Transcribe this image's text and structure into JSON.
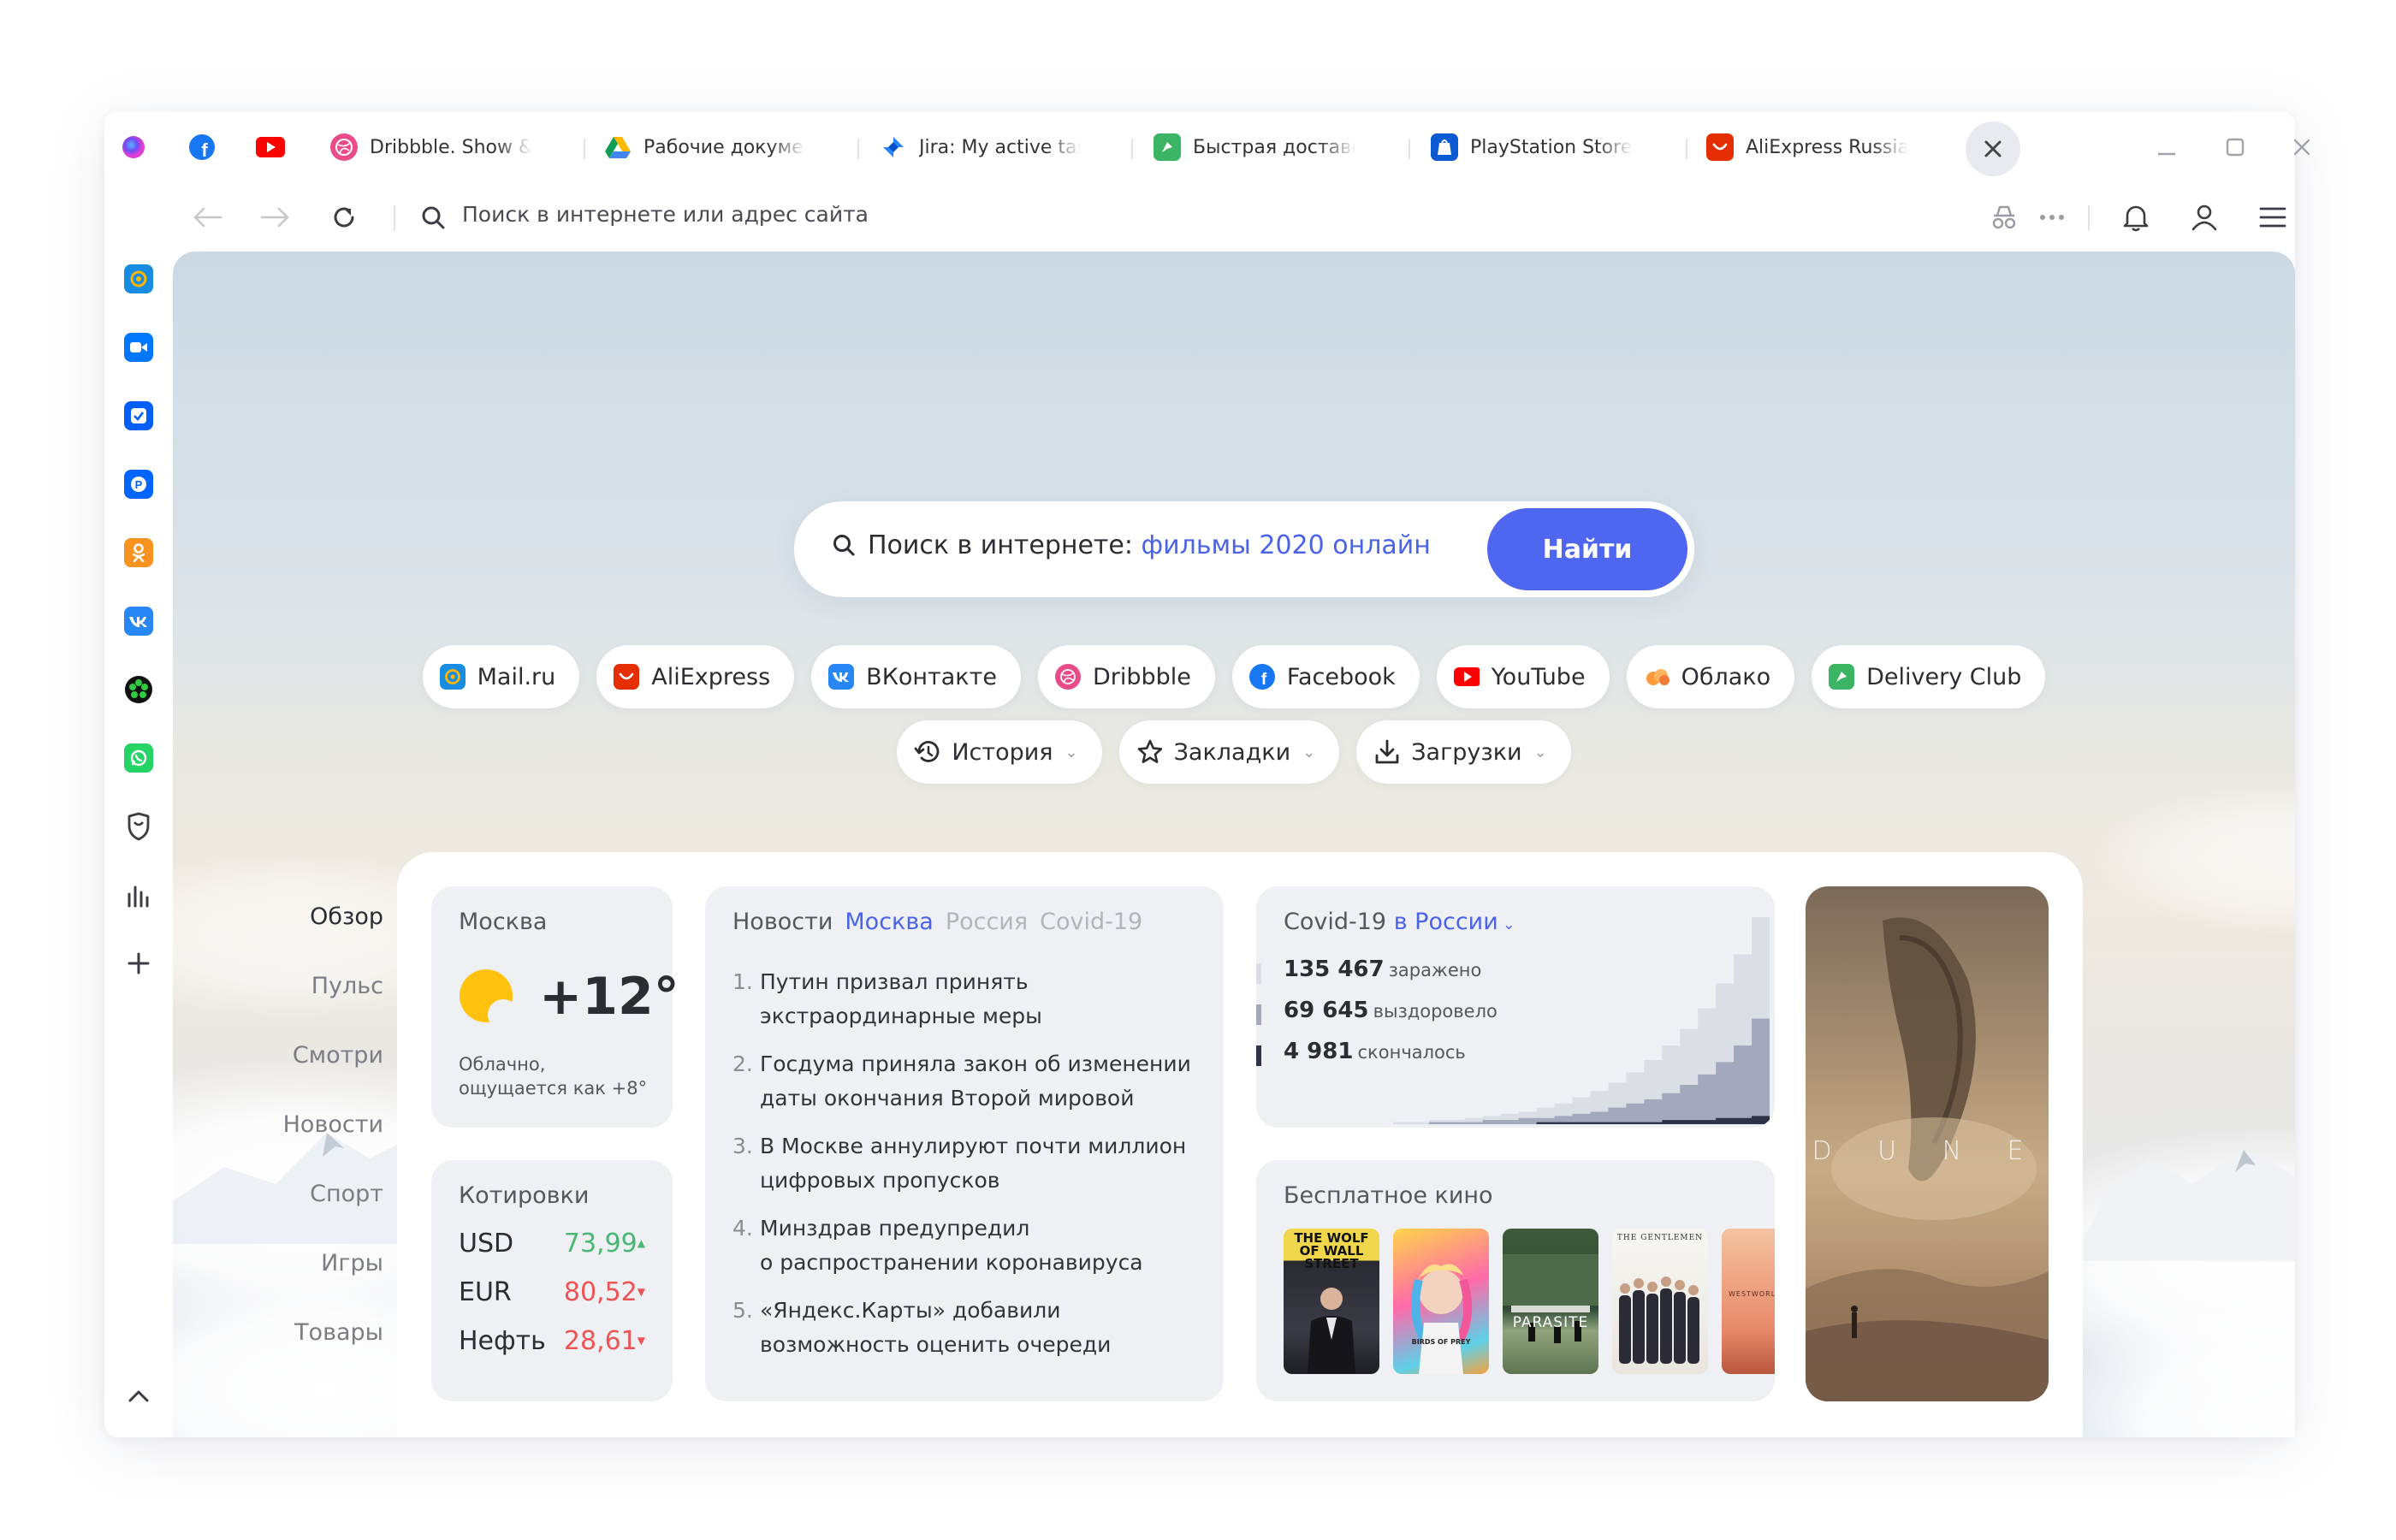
{
  "tabs": [
    {
      "title": "Dribbble. Show & tell for designers"
    },
    {
      "title": "Рабочие документы"
    },
    {
      "title": "Jira: My active tasks"
    },
    {
      "title": "Быстрая доставка"
    },
    {
      "title": "PlayStation Store"
    },
    {
      "title": "AliExpress Russia"
    }
  ],
  "toolbar": {
    "address_placeholder": "Поиск в интернете или адрес сайта"
  },
  "search": {
    "prefix": "Поиск в интернете: ",
    "query": "фильмы 2020 онлайн",
    "button": "Найти"
  },
  "quick_links": [
    "Mail.ru",
    "AliExpress",
    "ВКонтакте",
    "Dribbble",
    "Facebook",
    "YouTube",
    "Облако",
    "Delivery Club"
  ],
  "menus": [
    "История",
    "Закладки",
    "Загрузки"
  ],
  "left_nav": [
    "Обзор",
    "Пульс",
    "Смотри",
    "Новости",
    "Спорт",
    "Игры",
    "Товары"
  ],
  "weather": {
    "city": "Москва",
    "temp": "+12°",
    "desc1": "Облачно,",
    "desc2": "ощущается как +8°"
  },
  "rates": {
    "title": "Котировки",
    "items": [
      {
        "name": "USD",
        "value": "73,99",
        "dir": "up"
      },
      {
        "name": "EUR",
        "value": "80,52",
        "dir": "down"
      },
      {
        "name": "Нефть",
        "value": "28,61",
        "dir": "down"
      }
    ]
  },
  "news": {
    "tabs": [
      "Новости",
      "Москва",
      "Россия",
      "Covid-19"
    ],
    "items": [
      {
        "num": "1.",
        "l1": "Путин призвал принять",
        "l2": "экстраординарные меры"
      },
      {
        "num": "2.",
        "l1": "Госдума приняла закон об изменении",
        "l2": "даты окончания Второй мировой"
      },
      {
        "num": "3.",
        "l1": "В Москве аннулируют почти миллион",
        "l2": "цифровых пропусков"
      },
      {
        "num": "4.",
        "l1": "Минздрав предупредил",
        "l2": "о распространении коронавируса"
      },
      {
        "num": "5.",
        "l1": "«Яндекс.Карты» добавили",
        "l2": "возможность оценить очереди"
      }
    ]
  },
  "covid": {
    "title": "Covid-19",
    "region": "в России",
    "stats": [
      {
        "value": "135 467",
        "label": "заражено"
      },
      {
        "value": "69 645",
        "label": "выздоровело"
      },
      {
        "value": "4 981",
        "label": "скончалось"
      }
    ],
    "chart_data": {
      "type": "area",
      "series": [
        {
          "name": "заражено",
          "values": [
            1,
            1,
            2,
            2,
            3,
            4,
            5,
            6,
            8,
            10,
            13,
            16,
            20,
            25,
            31,
            38,
            46,
            56,
            68,
            82,
            100
          ]
        },
        {
          "name": "выздоровело",
          "values": [
            0,
            0,
            1,
            1,
            1,
            2,
            2,
            3,
            3,
            4,
            5,
            6,
            8,
            10,
            12,
            15,
            19,
            24,
            30,
            38,
            51
          ]
        },
        {
          "name": "скончалось",
          "values": [
            0,
            0,
            0,
            0,
            0,
            0,
            0,
            0,
            1,
            1,
            1,
            1,
            1,
            1,
            1,
            2,
            2,
            2,
            3,
            3,
            4
          ]
        }
      ]
    }
  },
  "free_movies": {
    "title": "Бесплатное кино",
    "posters": [
      "THE WOLF OF WALL STREET",
      "BIRDS OF PREY",
      "PARASITE",
      "THE GENTLEMEN",
      "WESTWORLD"
    ]
  },
  "promo": {
    "text": "D U N E"
  },
  "colors": {
    "accent": "#4f66f0",
    "up": "#49b774",
    "down": "#ef5454"
  }
}
